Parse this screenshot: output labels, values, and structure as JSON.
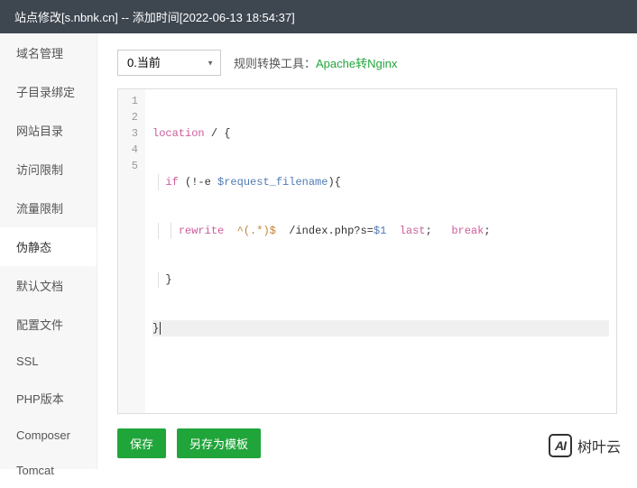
{
  "header": {
    "title": "站点修改[s.nbnk.cn] -- 添加时间[2022-06-13 18:54:37]"
  },
  "sidebar": {
    "items": [
      {
        "label": "域名管理"
      },
      {
        "label": "子目录绑定"
      },
      {
        "label": "网站目录"
      },
      {
        "label": "访问限制"
      },
      {
        "label": "流量限制"
      },
      {
        "label": "伪静态"
      },
      {
        "label": "默认文档"
      },
      {
        "label": "配置文件"
      },
      {
        "label": "SSL"
      },
      {
        "label": "PHP版本"
      },
      {
        "label": "Composer"
      },
      {
        "label": "Tomcat"
      }
    ],
    "activeIndex": 5
  },
  "topbar": {
    "selectValue": "0.当前",
    "toolLabel": "规则转换工具：",
    "toolLink": "Apache转Nginx"
  },
  "code": {
    "lines": [
      {
        "n": "1",
        "text": "location / {"
      },
      {
        "n": "2",
        "text": "  if (!-e $request_filename){"
      },
      {
        "n": "3",
        "text": "    rewrite  ^(.*)$  /index.php?s=$1  last;   break;"
      },
      {
        "n": "4",
        "text": "  }"
      },
      {
        "n": "5",
        "text": "}"
      }
    ]
  },
  "buttons": {
    "save": "保存",
    "saveAs": "另存为模板"
  },
  "brand": {
    "logoText": "AI",
    "name": "树叶云"
  }
}
